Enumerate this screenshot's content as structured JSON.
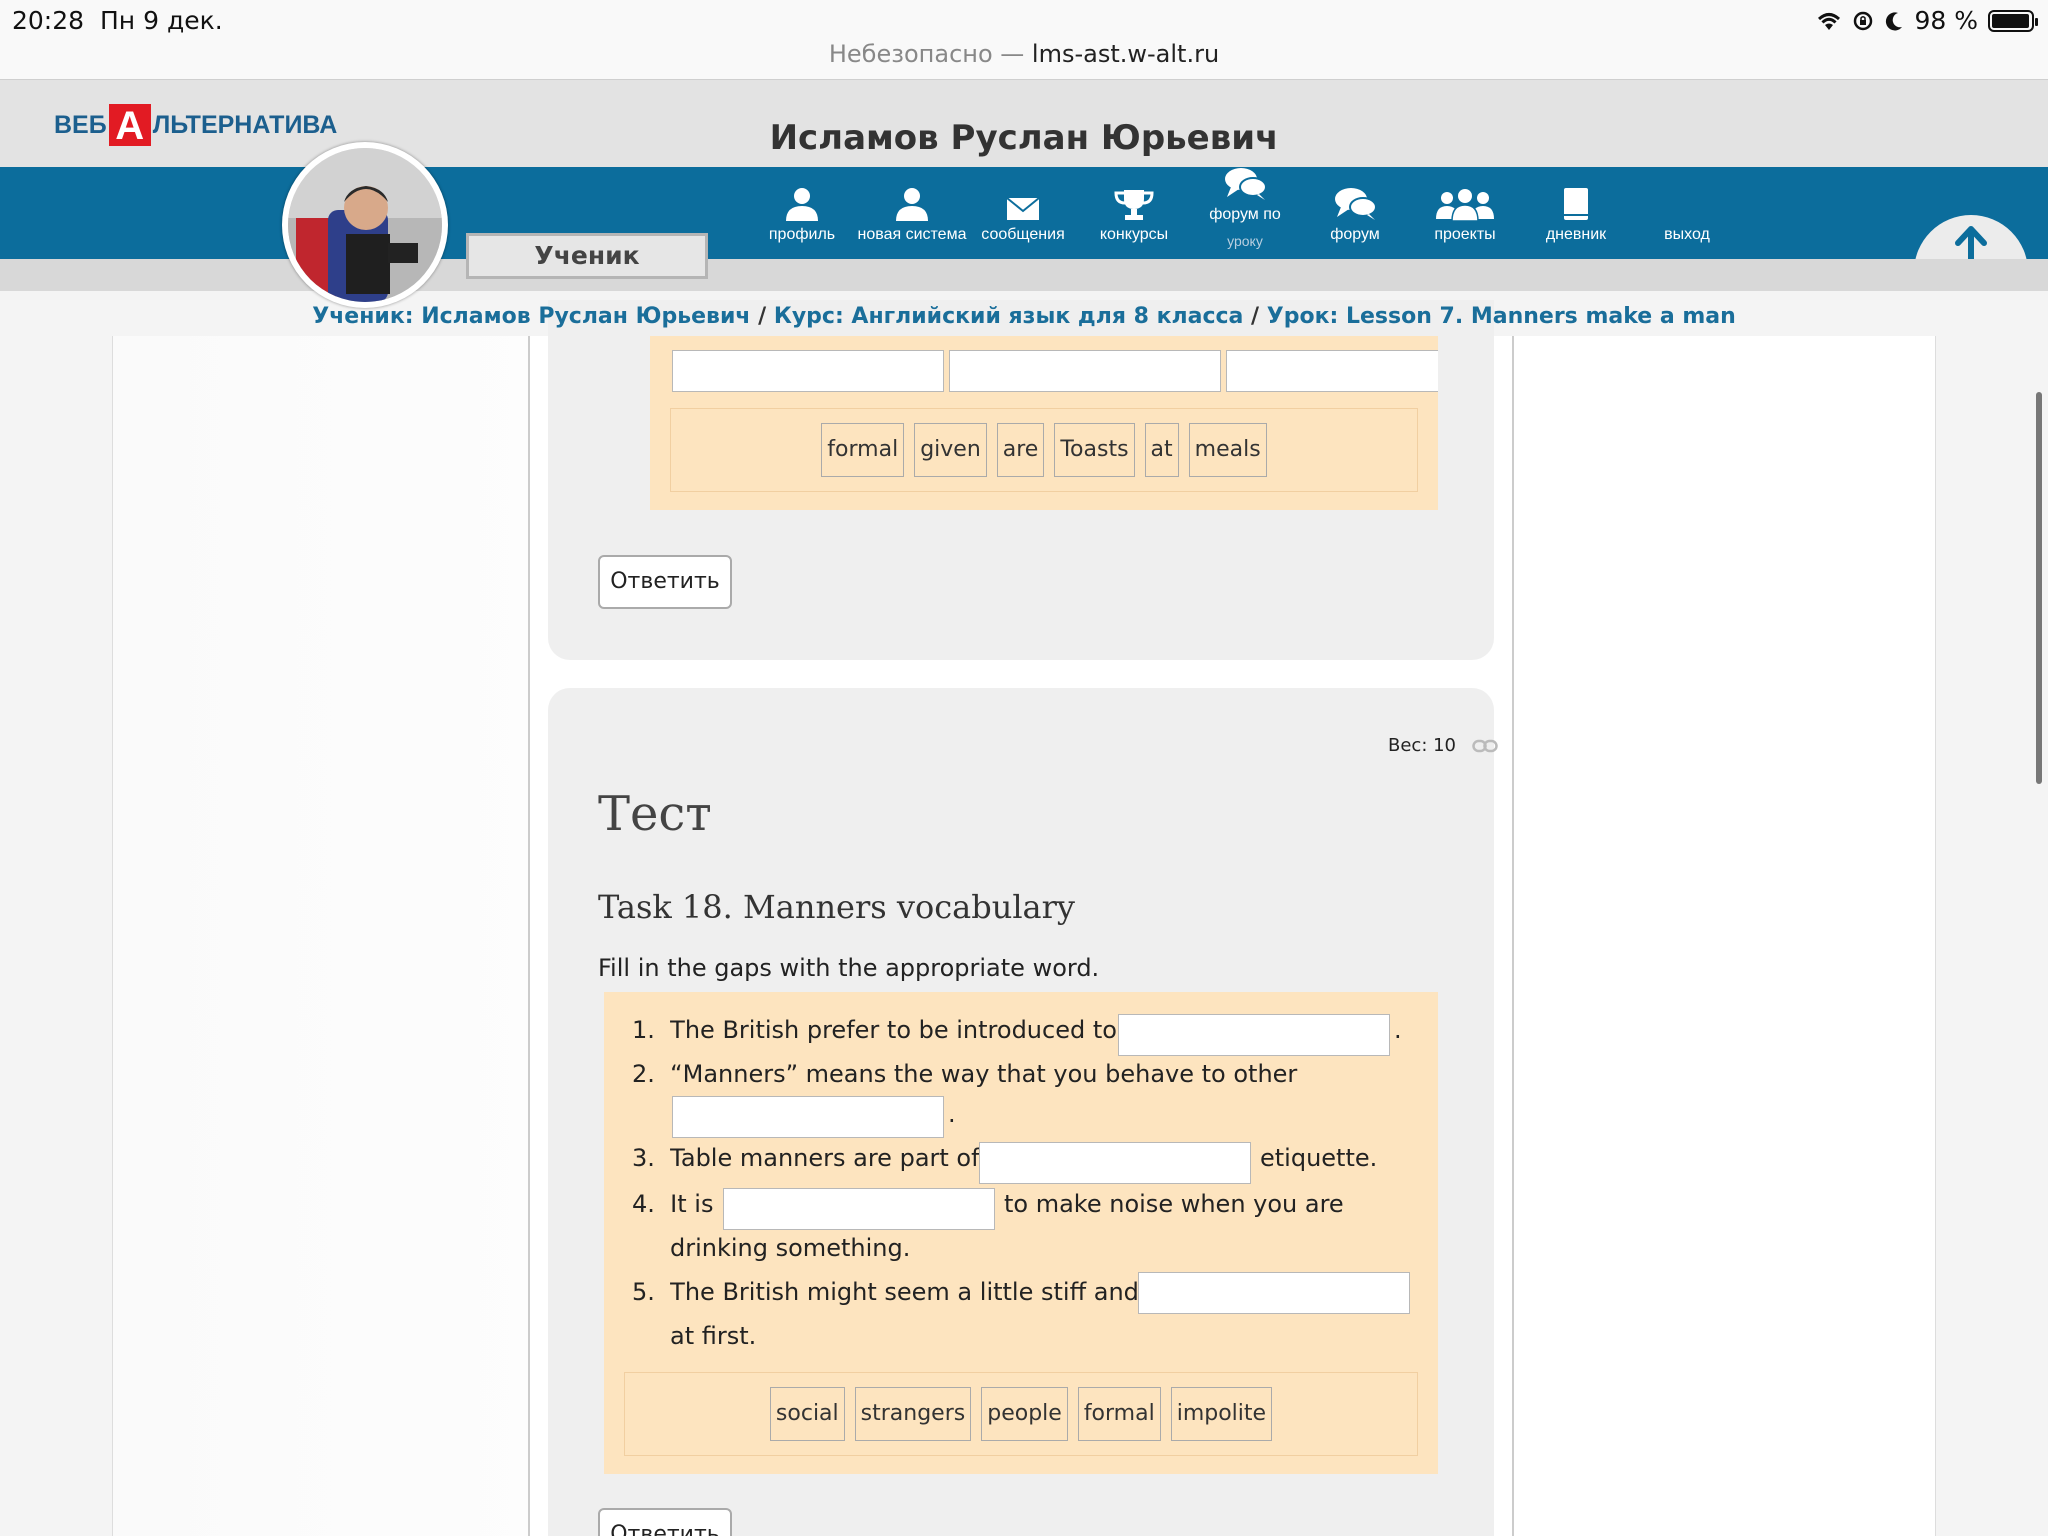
{
  "status": {
    "time": "20:28",
    "date": "Пн 9 дек.",
    "battery": "98 %",
    "battery_level": 0.98,
    "url_prefix": "Небезопасно — ",
    "url_host": "lms-ast.w-alt.ru"
  },
  "header": {
    "logo_left": "ВЕБ",
    "logo_letter": "А",
    "logo_right": "ЛЬТЕРНАТИВА",
    "user_name": "Исламов Руслан Юрьевич",
    "role": "Ученик"
  },
  "nav": {
    "profile": "профиль",
    "new_system": "новая система",
    "messages": "сообщения",
    "contests": "конкурсы",
    "lesson_forum": "форум по",
    "lesson_forum_sub": "уроку",
    "forum": "форум",
    "projects": "проекты",
    "diary": "дневник",
    "logout": "выход"
  },
  "breadcrumb": {
    "student": "Ученик: Исламов Руслан Юрьевич",
    "sep": " / ",
    "course": "Курс: Английский язык для 8 класса",
    "lesson": "Урок: Lesson 7. Manners make a man"
  },
  "task17": {
    "words": [
      "formal",
      "given",
      "are",
      "Toasts",
      "at",
      "meals"
    ],
    "answer_label": "Ответить"
  },
  "task18": {
    "weight": "Вес: 10",
    "section": "Тест",
    "title": "Task 18. Manners vocabulary",
    "instruction": "Fill in the gaps with the appropriate word.",
    "items": [
      {
        "num": "1.",
        "a": "The British prefer to be introduced to",
        "b": "."
      },
      {
        "num": "2.",
        "a": "“Manners” means the way that you behave to other",
        "b": "."
      },
      {
        "num": "3.",
        "a": "Table manners are part of",
        "b": "etiquette."
      },
      {
        "num": "4.",
        "a": "It is",
        "b": "to make noise when you are",
        "c": "drinking something."
      },
      {
        "num": "5.",
        "a": "The British might seem a little stiff and",
        "c": "at first."
      }
    ],
    "words": [
      "social",
      "strangers",
      "people",
      "formal",
      "impolite"
    ],
    "answer_label": "Ответить"
  }
}
